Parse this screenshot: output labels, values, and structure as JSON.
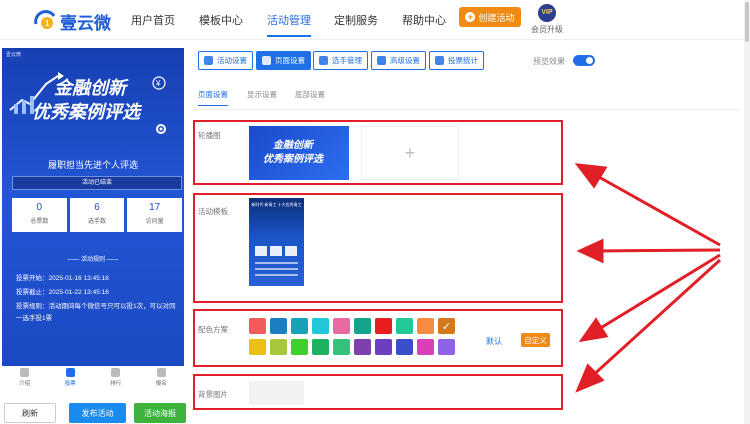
{
  "header": {
    "brand": "壹云微",
    "nav": [
      "用户首页",
      "模板中心",
      "活动管理",
      "定制服务",
      "帮助中心"
    ],
    "create_label": "创建活动",
    "vip_badge": "VIP",
    "vip_label": "会员升级"
  },
  "preview": {
    "tag": "壹云微",
    "banner_line1": "金融创新",
    "banner_line2": "优秀案例评选",
    "title": "履职担当先进个人评选",
    "status": "活动已结束",
    "stats": [
      {
        "value": "0",
        "label": "总票数"
      },
      {
        "value": "6",
        "label": "选手数"
      },
      {
        "value": "17",
        "label": "访问量"
      }
    ],
    "rules_heading": "—— 活动规则 ——",
    "rules": [
      "投票开始：2025-01-16 13:45:16",
      "投票截止：2025-01-22 13:45:16",
      "投票规则：活动期间每个微信号只可以投1次，可以对同一选手投1票"
    ],
    "tabs": [
      "介绍",
      "投票",
      "排行",
      "报名"
    ],
    "buttons": {
      "refresh": "刷新",
      "publish": "发布活动",
      "poster": "活动海报"
    }
  },
  "toolbar": {
    "items": [
      "活动设置",
      "页面设置",
      "选手管理",
      "高级设置",
      "投票统计"
    ],
    "preview_toggle_label": "预览效果"
  },
  "subtabs": [
    "页面设置",
    "显示设置",
    "底部设置"
  ],
  "sections": {
    "carousel_label": "轮播图",
    "carousel_thumb_line1": "金融创新",
    "carousel_thumb_line2": "优秀案例评选",
    "add_symbol": "+",
    "template_label": "活动模板",
    "template_thumb_text": "新时代 新青工 十大优秀青工",
    "color_label": "配色方案",
    "default_label": "默认",
    "custom_label": "自定义",
    "bg_label": "背景图片"
  },
  "colors": {
    "accent": "#1f6fe6",
    "orange": "#f08a15",
    "annotation_red": "#e01f26",
    "swatches": [
      "#f15b5b",
      "#1b7ec2",
      "#17a2b8",
      "#20c7d8",
      "#e86aa0",
      "#14a38b",
      "#e61e1e",
      "#1fc99a",
      "#f58c42",
      "#d4781c",
      "#ecbf14",
      "#a7c83a",
      "#3ed12d",
      "#1fb060",
      "#34c27a",
      "#7e3fb0",
      "#6b3fbf",
      "#3b4fc9",
      "#d93fb8",
      "#8f63e8"
    ],
    "selected_swatch_index": 9
  },
  "icons": [
    "logo-icon",
    "plus-icon",
    "vip-icon",
    "toggle-icon",
    "arrow-annotation"
  ]
}
